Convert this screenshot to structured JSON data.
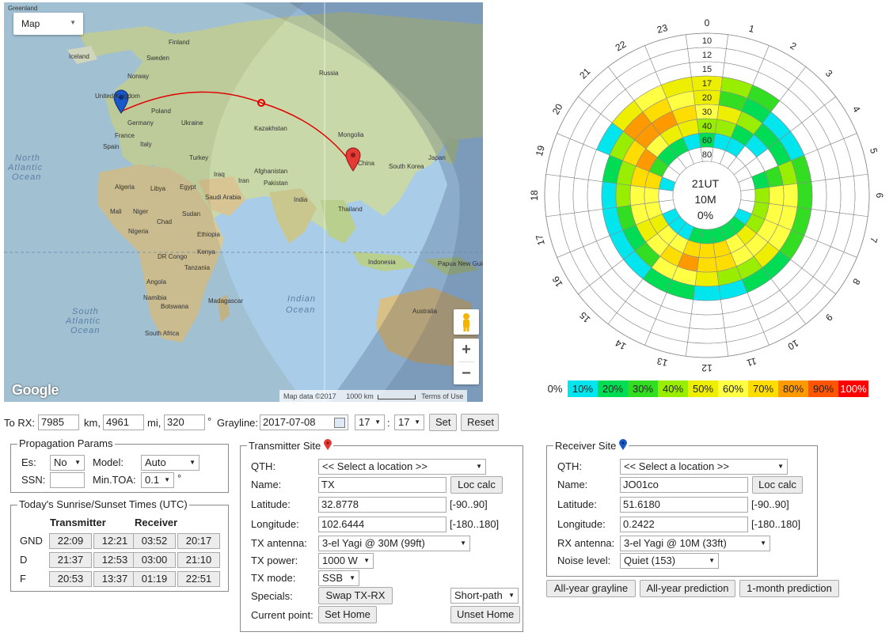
{
  "map": {
    "type_select": "Map",
    "labels": {
      "greenland": "Greenland",
      "iceland": "Iceland",
      "finland": "Finland",
      "sweden": "Sweden",
      "norway": "Norway",
      "united_kingdom": "United Kingdom",
      "poland": "Poland",
      "germany": "Germany",
      "ukraine": "Ukraine",
      "france": "France",
      "spain": "Spain",
      "italy": "Italy",
      "turkey": "Turkey",
      "russia": "Russia",
      "kazakhstan": "Kazakhstan",
      "mongolia": "Mongolia",
      "china": "China",
      "japan": "Japan",
      "south_korea": "South Korea",
      "iraq": "Iraq",
      "iran": "Iran",
      "afghanistan": "Afghanistan",
      "pakistan": "Pakistan",
      "india": "India",
      "thailand": "Thailand",
      "algeria": "Algeria",
      "libya": "Libya",
      "egypt": "Egypt",
      "saudi_arabia": "Saudi Arabia",
      "mali": "Mali",
      "niger": "Niger",
      "chad": "Chad",
      "sudan": "Sudan",
      "nigeria": "Nigeria",
      "ethiopia": "Ethiopia",
      "kenya": "Kenya",
      "dr_congo": "DR Congo",
      "tanzania": "Tanzania",
      "angola": "Angola",
      "namibia": "Namibia",
      "botswana": "Botswana",
      "madagascar": "Madagascar",
      "south_africa": "South Africa",
      "indonesia": "Indonesia",
      "papua_new_guinea": "Papua New Guinea",
      "australia": "Australia"
    },
    "oceans": {
      "north_atlantic": [
        "North",
        "Atlantic",
        "Ocean"
      ],
      "south_atlantic": [
        "South",
        "Atlantic",
        "Ocean"
      ],
      "indian": [
        "Indian",
        "Ocean"
      ]
    },
    "logo": "Google",
    "attribution": [
      "Map data ©2017",
      "1000 km",
      "Terms of Use"
    ],
    "zoom_in": "+",
    "zoom_out": "−",
    "pegman_icon": "pegman-icon"
  },
  "polar": {
    "center": [
      "21UT",
      "10M",
      "0%"
    ],
    "hours": [
      "0",
      "1",
      "2",
      "3",
      "4",
      "5",
      "6",
      "7",
      "8",
      "9",
      "10",
      "11",
      "12",
      "13",
      "14",
      "15",
      "16",
      "17",
      "18",
      "19",
      "20",
      "21",
      "22",
      "23"
    ],
    "rings": [
      "10",
      "12",
      "15",
      "17",
      "20",
      "30",
      "40",
      "60",
      "80"
    ],
    "legend": [
      "0%",
      "10%",
      "20%",
      "30%",
      "40%",
      "50%",
      "60%",
      "70%",
      "80%",
      "90%",
      "100%"
    ],
    "legend_colors": [
      "#ffffff",
      "#00e5ee",
      "#00dd55",
      "#33dd22",
      "#99ee00",
      "#eeee00",
      "#ffff44",
      "#ffdd00",
      "#ff9900",
      "#ff5500",
      "#ff0000"
    ]
  },
  "controls": {
    "to_rx_label": "To RX:",
    "km": "7985",
    "km_label": "km,",
    "mi": "4961",
    "mi_label": "mi,",
    "deg": "320",
    "deg_label": "°",
    "grayline_label": "Grayline:",
    "date": "2017-07-08",
    "hour": "17",
    "colon": ":",
    "minute": "17",
    "set": "Set",
    "reset": "Reset"
  },
  "prop": {
    "title": "Propagation Params",
    "es_label": "Es:",
    "es_value": "No",
    "model_label": "Model:",
    "model_value": "Auto",
    "ssn_label": "SSN:",
    "ssn_value": "",
    "mintoa_label": "Min.TOA:",
    "mintoa_value": "0.1",
    "deg": "°"
  },
  "sun": {
    "title": "Today's Sunrise/Sunset Times (UTC)",
    "tx_header": "Transmitter",
    "rx_header": "Receiver",
    "rows": [
      {
        "label": "GND",
        "t": [
          "22:09",
          "12:21",
          "03:52",
          "20:17"
        ]
      },
      {
        "label": "D",
        "t": [
          "21:37",
          "12:53",
          "03:00",
          "21:10"
        ]
      },
      {
        "label": "F",
        "t": [
          "20:53",
          "13:37",
          "01:19",
          "22:51"
        ]
      }
    ]
  },
  "tx": {
    "title": "Transmitter Site",
    "qth_label": "QTH:",
    "qth_value": "<< Select a location >>",
    "name_label": "Name:",
    "name_value": "TX",
    "loc_calc": "Loc calc",
    "lat_label": "Latitude:",
    "lat_value": "32.8778",
    "lat_range": "[-90..90]",
    "lon_label": "Longitude:",
    "lon_value": "102.6444",
    "lon_range": "[-180..180]",
    "ant_label": "TX antenna:",
    "ant_value": "3-el Yagi @ 30M (99ft)",
    "power_label": "TX power:",
    "power_value": "1000 W",
    "mode_label": "TX mode:",
    "mode_value": "SSB",
    "specials_label": "Specials:",
    "swap": "Swap TX-RX",
    "path": "Short-path",
    "current_label": "Current point:",
    "set_home": "Set Home",
    "unset_home": "Unset Home"
  },
  "rx": {
    "title": "Receiver Site",
    "qth_label": "QTH:",
    "qth_value": "<< Select a location >>",
    "name_label": "Name:",
    "name_value": "JO01co",
    "loc_calc": "Loc calc",
    "lat_label": "Latitude:",
    "lat_value": "51.6180",
    "lat_range": "[-90..90]",
    "lon_label": "Longitude:",
    "lon_value": "0.2422",
    "lon_range": "[-180..180]",
    "ant_label": "RX antenna:",
    "ant_value": "3-el Yagi @ 10M (33ft)",
    "noise_label": "Noise level:",
    "noise_value": "Quiet (153)"
  },
  "bottom_buttons": {
    "grayline": "All-year grayline",
    "prediction": "All-year prediction",
    "month": "1-month prediction"
  },
  "colors": {
    "tx_marker": "#e53935",
    "rx_marker": "#1a57c9",
    "path": "#e00000"
  }
}
